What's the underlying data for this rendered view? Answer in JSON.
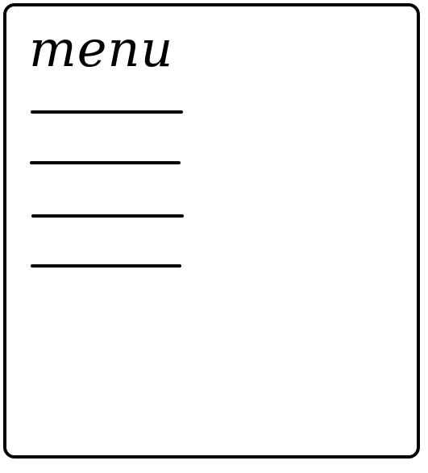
{
  "menu": {
    "title": "menu",
    "items": [
      {
        "kind": "placeholder-line"
      },
      {
        "kind": "placeholder-line"
      },
      {
        "kind": "placeholder-line"
      },
      {
        "kind": "placeholder-line"
      }
    ]
  },
  "colors": {
    "border": "#000000",
    "background": "#ffffff",
    "text": "#000000"
  }
}
